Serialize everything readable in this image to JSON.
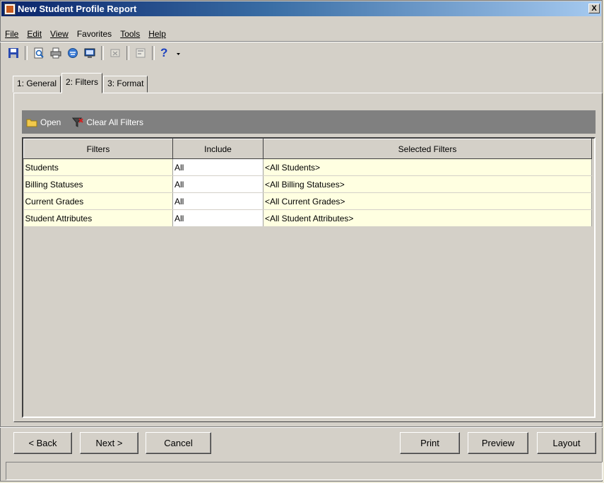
{
  "window": {
    "title": "New Student Profile Report",
    "close_label": "X"
  },
  "menu": [
    {
      "label": "File",
      "key": "F"
    },
    {
      "label": "Edit",
      "key": "E"
    },
    {
      "label": "View",
      "key": "V"
    },
    {
      "label": "Favorites",
      "key": "a"
    },
    {
      "label": "Tools",
      "key": "T"
    },
    {
      "label": "Help",
      "key": "H"
    }
  ],
  "toolbar": {
    "icons": [
      "save-icon",
      "print-preview-icon",
      "print-icon",
      "email-icon",
      "export-icon",
      "delete-icon",
      "properties-icon",
      "help-icon"
    ],
    "help_label": "?"
  },
  "tabs": [
    {
      "label": "1: General",
      "active": false
    },
    {
      "label": "2: Filters",
      "active": true
    },
    {
      "label": "3: Format",
      "active": false
    }
  ],
  "filter_bar": {
    "open_label": "Open",
    "clear_label": "Clear All Filters"
  },
  "grid": {
    "headers": [
      "Filters",
      "Include",
      "Selected Filters"
    ],
    "rows": [
      {
        "filter": "Students",
        "include": "All",
        "selected": "<All Students>"
      },
      {
        "filter": "Billing Statuses",
        "include": "All",
        "selected": "<All Billing Statuses>"
      },
      {
        "filter": "Current Grades",
        "include": "All",
        "selected": "<All Current Grades>"
      },
      {
        "filter": "Student Attributes",
        "include": "All",
        "selected": "<All Student Attributes>"
      }
    ]
  },
  "buttons": {
    "back": "< Back",
    "next": "Next >",
    "cancel": "Cancel",
    "print": "Print",
    "preview": "Preview",
    "layout": "Layout"
  },
  "status_text": ""
}
